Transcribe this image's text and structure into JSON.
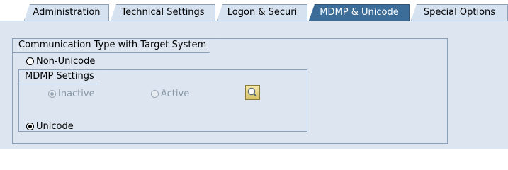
{
  "tabs": [
    {
      "label": "Administration",
      "active": false
    },
    {
      "label": "Technical Settings",
      "active": false
    },
    {
      "label": "Logon & Securi",
      "active": false
    },
    {
      "label": "MDMP & Unicode",
      "active": true
    },
    {
      "label": "Special Options",
      "active": false
    }
  ],
  "communication_group": {
    "title": "Communication Type with Target System",
    "non_unicode_label": "Non-Unicode",
    "non_unicode_selected": false,
    "unicode_label": "Unicode",
    "unicode_selected": true
  },
  "mdmp_settings": {
    "title": "MDMP Settings",
    "inactive_label": "Inactive",
    "inactive_selected": true,
    "active_label": "Active",
    "active_selected": false,
    "enabled": false,
    "details_icon": "search-icon"
  },
  "colors": {
    "active_tab": "#3c6c98",
    "inactive_tab": "#d6e2f0",
    "panel_background": "#dde6f0",
    "border": "#8aa0b8"
  }
}
